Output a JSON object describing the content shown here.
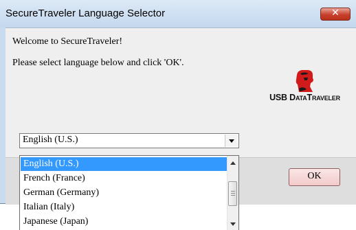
{
  "window": {
    "title": "SecureTraveler Language Selector",
    "close_symbol": "✕"
  },
  "main": {
    "welcome_text": "Welcome to SecureTraveler!",
    "instruction_text": "Please select language below and click 'OK'.",
    "logo_text": "USB DataTraveler",
    "logo_icon": "kingston-head-logo"
  },
  "language_select": {
    "value": "English (U.S.)",
    "options": [
      "English (U.S.)",
      "French (France)",
      "German (Germany)",
      "Italian (Italy)",
      "Japanese (Japan)"
    ]
  },
  "buttons": {
    "ok_label": "OK"
  },
  "colors": {
    "selection": "#3399ff",
    "logo_red": "#d11b1b",
    "close_button": "#c8412d"
  }
}
